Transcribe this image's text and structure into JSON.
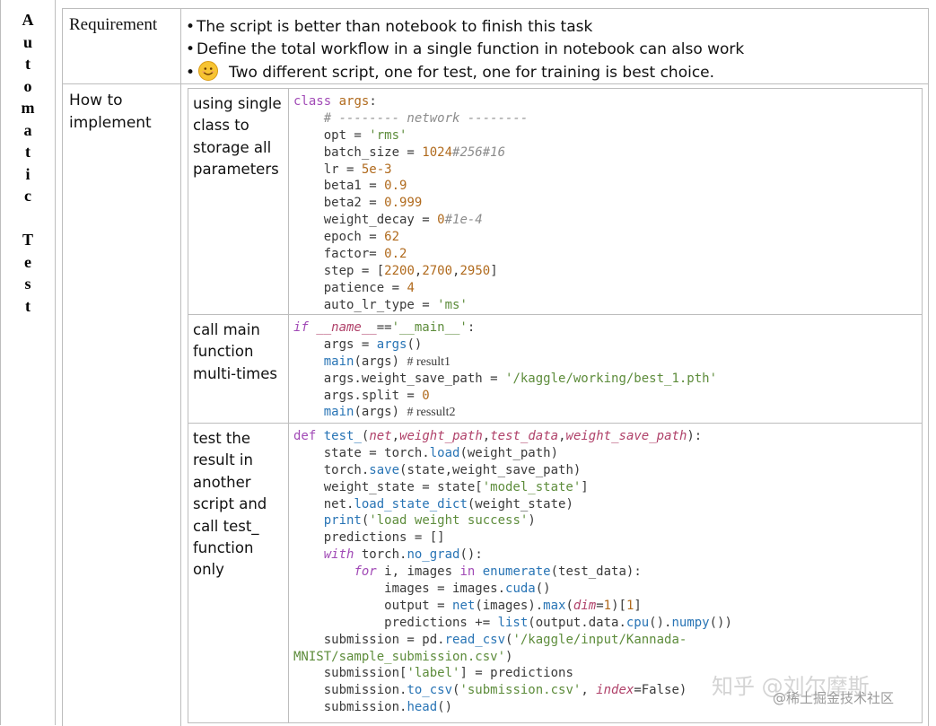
{
  "vertical_title": [
    "A",
    "u",
    "t",
    "o",
    "m",
    "a",
    "t",
    "i",
    "c",
    " ",
    "T",
    "e",
    "s",
    "t"
  ],
  "requirement": {
    "label": "Requirement",
    "items": [
      "The script is better than notebook to finish this task",
      "Define the total workflow in a single function in notebook can also work",
      "Two different script, one for test, one for training is best choice."
    ],
    "bullet": "•",
    "emoji_icon": "smiling-face-icon"
  },
  "how_to": {
    "label_line1": "How to",
    "label_line2": "implement",
    "rows": [
      {
        "label": "using single class to storage all parameters",
        "code": {
          "l1": [
            "class",
            "args",
            ":"
          ],
          "l2": "    # -------- network --------",
          "l3": [
            "    opt = ",
            "'rms'"
          ],
          "l4": [
            "    batch_size = ",
            "1024",
            "#256#16"
          ],
          "l5": [
            "    lr = ",
            "5e-3"
          ],
          "l6": [
            "    beta1 = ",
            "0.9"
          ],
          "l7": [
            "    beta2 = ",
            "0.999"
          ],
          "l8": [
            "    weight_decay = ",
            "0",
            "#1e-4"
          ],
          "l9": [
            "    epoch = ",
            "62"
          ],
          "l10": [
            "    factor= ",
            "0.2"
          ],
          "l11": [
            "    step = [",
            "2200",
            ",",
            "2700",
            ",",
            "2950",
            "]"
          ],
          "l12": [
            "    patience = ",
            "4"
          ],
          "l13": [
            "    auto_lr_type = ",
            "'ms'"
          ]
        }
      },
      {
        "label": "call main function multi-times",
        "code": {
          "l1": [
            "if",
            " __name__",
            "==",
            "'__main__'",
            ":"
          ],
          "l2": [
            "    args = ",
            "args",
            "()"
          ],
          "l3": [
            "    ",
            "main",
            "(args) ",
            "# result1"
          ],
          "l4": [
            "    args.weight_save_path = ",
            "'/kaggle/working/best_1.pth'"
          ],
          "l5": [
            "    args.split = ",
            "0"
          ],
          "l6": [
            "    ",
            "main",
            "(args) ",
            "# ressult2"
          ]
        }
      },
      {
        "label": "test the result in another script and call test_ function only",
        "code": {
          "l1": [
            "def",
            " ",
            "test_",
            "(",
            "net",
            ",",
            "weight_path",
            ",",
            "test_data",
            ",",
            "weight_save_path",
            "):"
          ],
          "l2": [
            "    state = torch.",
            "load",
            "(weight_path)"
          ],
          "l3": [
            "    torch.",
            "save",
            "(state,weight_save_path)"
          ],
          "l4": [
            "    weight_state = state[",
            "'model_state'",
            "]"
          ],
          "l5": [
            "    net.",
            "load_state_dict",
            "(weight_state)"
          ],
          "l6": [
            "    ",
            "print",
            "(",
            "'load weight success'",
            ")"
          ],
          "l7": "    predictions = []",
          "l8": [
            "    ",
            "with",
            " torch.",
            "no_grad",
            "():"
          ],
          "l9": [
            "        ",
            "for",
            " i, images ",
            "in",
            " ",
            "enumerate",
            "(test_data):"
          ],
          "l10": [
            "            images = images.",
            "cuda",
            "()"
          ],
          "l11": [
            "            output = ",
            "net",
            "(images).",
            "max",
            "(",
            "dim",
            "=",
            "1",
            ")[",
            "1",
            "]"
          ],
          "l12": [
            "            predictions += ",
            "list",
            "(output.data.",
            "cpu",
            "().",
            "numpy",
            "())"
          ],
          "l13": [
            "    submission = pd.",
            "read_csv",
            "(",
            "'/kaggle/input/Kannada-"
          ],
          "l14": [
            "MNIST/sample_submission.csv'",
            ")"
          ],
          "l15": [
            "    submission[",
            "'label'",
            "] = predictions"
          ],
          "l16": [
            "    submission.",
            "to_csv",
            "(",
            "'submission.csv'",
            ", ",
            "index",
            "=False)"
          ],
          "l17": [
            "    submission.",
            "head",
            "()"
          ]
        }
      }
    ]
  },
  "watermark": {
    "main": "知乎 @刘尔摩斯",
    "sub": "@稀土掘金技术社区"
  }
}
